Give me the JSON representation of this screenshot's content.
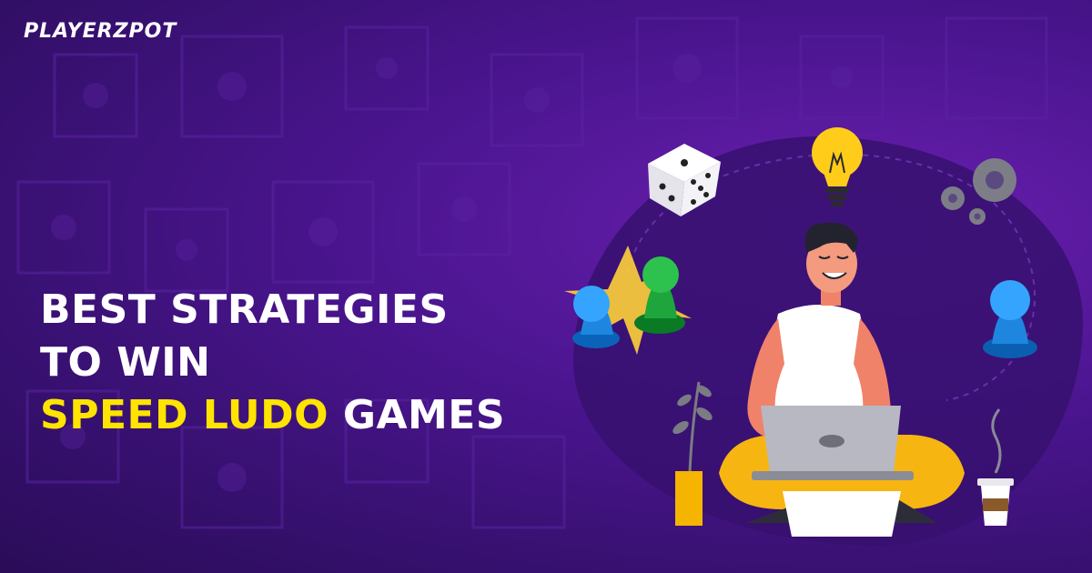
{
  "brand": {
    "name": "PLAYERZPOT"
  },
  "headline": {
    "line1": "BEST STRATEGIES",
    "line2": "TO WIN",
    "line3_highlight": "SPEED LUDO",
    "line3_rest": " GAMES"
  },
  "colors": {
    "background": "#4b1590",
    "highlight": "#ffe400",
    "text": "#ffffff"
  },
  "icons": [
    "dice-icon",
    "lightbulb-icon",
    "gears-icon",
    "ludo-pawns-icon",
    "blue-pawn-icon",
    "plant-icon",
    "coffee-cup-icon"
  ]
}
